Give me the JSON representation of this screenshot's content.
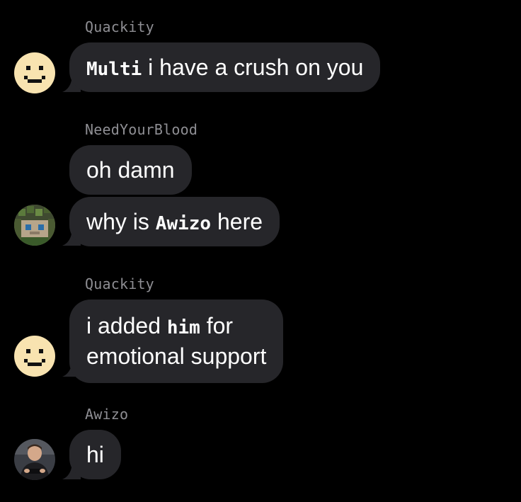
{
  "chat": {
    "groups": [
      {
        "sender": "Quackity",
        "avatar_icon": "pixel-smiley-face-icon",
        "messages": [
          {
            "mention": "Multi",
            "text": "i have a crush on you"
          }
        ]
      },
      {
        "sender": "NeedYourBlood",
        "avatar_icon": "pixelated-green-hair-avatar-icon",
        "messages": [
          {
            "text": "oh damn"
          },
          {
            "prefix": "why is",
            "mention": "Awizo",
            "suffix": "here"
          }
        ]
      },
      {
        "sender": "Quackity",
        "avatar_icon": "pixel-smiley-face-icon",
        "messages": [
          {
            "prefix": "i added",
            "mention": "him",
            "suffix": "for",
            "line2": "emotional support"
          }
        ]
      },
      {
        "sender": "Awizo",
        "avatar_icon": "person-photo-avatar-icon",
        "messages": [
          {
            "text": "hi"
          }
        ]
      }
    ]
  },
  "colors": {
    "background": "#000000",
    "bubble": "#26262a",
    "sender_name": "#8e8e93",
    "text": "#ffffff",
    "smiley_face": "#f8e3b0"
  }
}
